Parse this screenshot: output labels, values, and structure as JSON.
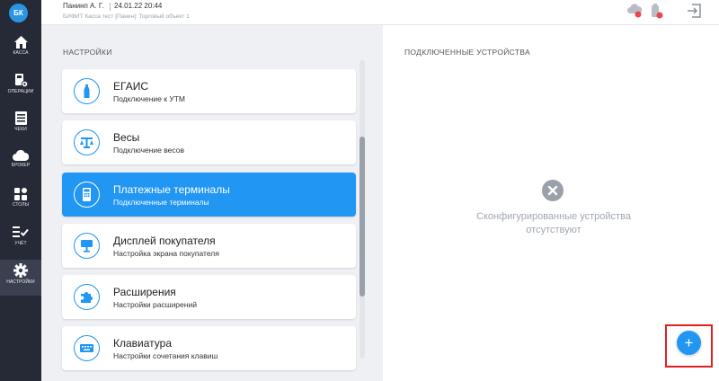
{
  "sidebar": {
    "logo": "БК",
    "items": [
      {
        "label": "КАССА",
        "icon": "home-icon"
      },
      {
        "label": "ОПЕРАЦИИ",
        "icon": "operations-icon"
      },
      {
        "label": "ЧЕКИ",
        "icon": "receipts-icon"
      },
      {
        "label": "БРОКЕР",
        "icon": "cloud-icon"
      },
      {
        "label": "СТОЛЫ",
        "icon": "tables-icon"
      },
      {
        "label": "УЧЁТ",
        "icon": "accounting-icon"
      },
      {
        "label": "НАСТРОЙКИ",
        "icon": "settings-icon"
      }
    ],
    "active_index": 6
  },
  "header": {
    "user": "Панинп А. Г.",
    "datetime": "24.01.22 20:44",
    "subtitle": "БИФИТ Касса тест [Панин]: Торговый объект 1",
    "icons": [
      "cloud-status-icon",
      "battery-status-icon",
      "logout-icon"
    ]
  },
  "settings": {
    "title": "НАСТРОЙКИ",
    "items": [
      {
        "title": "ЕГАИС",
        "subtitle": "Подключение к УТМ",
        "icon": "bottle-icon"
      },
      {
        "title": "Весы",
        "subtitle": "Подключение весов",
        "icon": "scales-icon"
      },
      {
        "title": "Платежные терминалы",
        "subtitle": "Подключенные терминалы",
        "icon": "terminal-icon"
      },
      {
        "title": "Дисплей покупателя",
        "subtitle": "Настройка экрана покупателя",
        "icon": "display-icon"
      },
      {
        "title": "Расширения",
        "subtitle": "Настройки расширений",
        "icon": "puzzle-icon"
      },
      {
        "title": "Клавиатура",
        "subtitle": "Настройки сочетания клавиш",
        "icon": "keyboard-icon"
      }
    ],
    "active_index": 2
  },
  "devices": {
    "title": "ПОДКЛЮЧЕННЫЕ УСТРОЙСТВА",
    "empty_line1": "Сконфигурированные устройства",
    "empty_line2": "отсутствуют",
    "add_label": "+"
  },
  "colors": {
    "accent": "#2196f3",
    "sidebar": "#252a36",
    "highlight": "#e02020"
  }
}
